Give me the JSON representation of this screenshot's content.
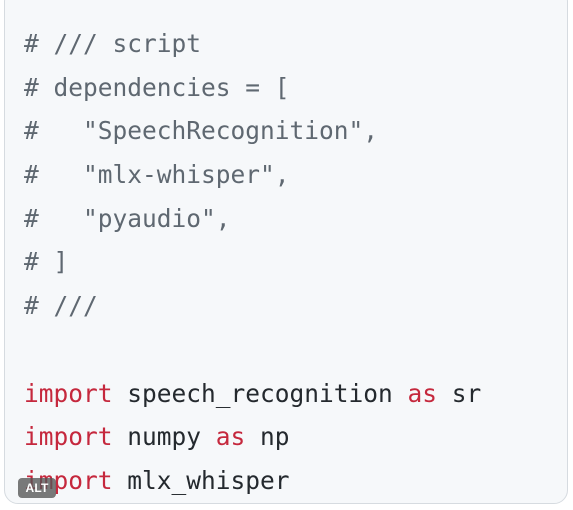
{
  "code": {
    "lines": [
      [
        {
          "text": "# /// script",
          "cls": "comment"
        }
      ],
      [
        {
          "text": "# dependencies = [",
          "cls": "comment"
        }
      ],
      [
        {
          "text": "#   \"SpeechRecognition\",",
          "cls": "comment"
        }
      ],
      [
        {
          "text": "#   \"mlx-whisper\",",
          "cls": "comment"
        }
      ],
      [
        {
          "text": "#   \"pyaudio\",",
          "cls": "comment"
        }
      ],
      [
        {
          "text": "# ]",
          "cls": "comment"
        }
      ],
      [
        {
          "text": "# ///",
          "cls": "comment"
        }
      ],
      [],
      [
        {
          "text": "import",
          "cls": "kw"
        },
        {
          "text": " speech_recognition ",
          "cls": "plain"
        },
        {
          "text": "as",
          "cls": "kw"
        },
        {
          "text": " sr",
          "cls": "plain"
        }
      ],
      [
        {
          "text": "import",
          "cls": "kw"
        },
        {
          "text": " numpy ",
          "cls": "plain"
        },
        {
          "text": "as",
          "cls": "kw"
        },
        {
          "text": " np",
          "cls": "plain"
        }
      ],
      [
        {
          "text": "import",
          "cls": "kw"
        },
        {
          "text": " mlx_whisper",
          "cls": "plain"
        }
      ]
    ]
  },
  "badge": {
    "alt_label": "ALT"
  },
  "colors": {
    "keyword": "#c5283d",
    "comment": "#5f6871",
    "text": "#24292e",
    "background": "#f6f8fa"
  }
}
